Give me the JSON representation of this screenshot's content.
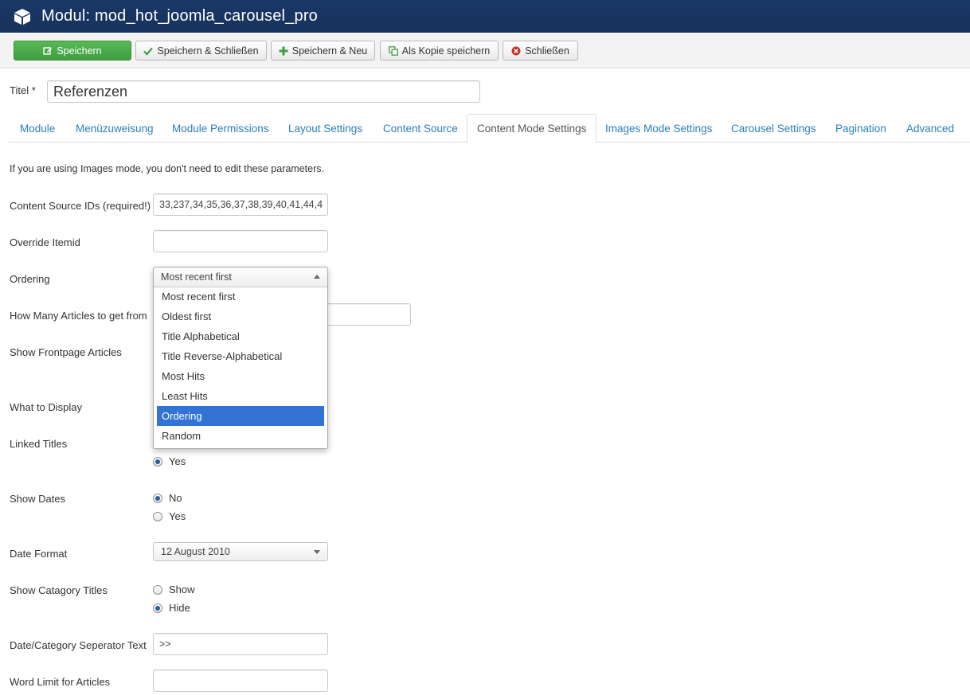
{
  "header": {
    "title": "Modul: mod_hot_joomla_carousel_pro"
  },
  "toolbar": {
    "save": "Speichern",
    "save_close": "Speichern & Schließen",
    "save_new": "Speichern & Neu",
    "save_copy": "Als Kopie speichern",
    "close": "Schließen"
  },
  "title_field": {
    "label": "Titel *",
    "value": "Referenzen"
  },
  "tabs": [
    "Module",
    "Menüzuweisung",
    "Module Permissions",
    "Layout Settings",
    "Content Source",
    "Content Mode Settings",
    "Images Mode Settings",
    "Carousel Settings",
    "Pagination",
    "Advanced"
  ],
  "active_tab": "Content Mode Settings",
  "note": "If you are using Images mode, you don't need to edit these parameters.",
  "fields": {
    "content_source_ids": {
      "label": "Content Source IDs (required!)",
      "value": "33,237,34,35,36,37,38,39,40,41,44,4"
    },
    "override_itemid": {
      "label": "Override Itemid",
      "value": ""
    },
    "ordering": {
      "label": "Ordering",
      "value": "Most recent first",
      "options": [
        "Most recent first",
        "Oldest first",
        "Title Alphabetical",
        "Title Reverse-Alphabetical",
        "Most Hits",
        "Least Hits",
        "Ordering",
        "Random"
      ],
      "highlighted": "Ordering"
    },
    "how_many": {
      "label": "How Many Articles to get from"
    },
    "show_frontpage": {
      "label": "Show Frontpage Articles"
    },
    "what_to_display": {
      "label": "What to Display"
    },
    "linked_titles": {
      "label": "Linked Titles",
      "options": [
        "Yes"
      ]
    },
    "show_dates": {
      "label": "Show Dates",
      "options": [
        "No",
        "Yes"
      ],
      "selected": "No"
    },
    "date_format": {
      "label": "Date Format",
      "value": "12 August 2010"
    },
    "show_category_titles": {
      "label": "Show Catagory Titles",
      "options": [
        "Show",
        "Hide"
      ],
      "selected": "Hide"
    },
    "separator_text": {
      "label": "Date/Category Seperator Text",
      "value": ">>"
    },
    "word_limit": {
      "label": "Word Limit for Articles",
      "value": ""
    }
  }
}
